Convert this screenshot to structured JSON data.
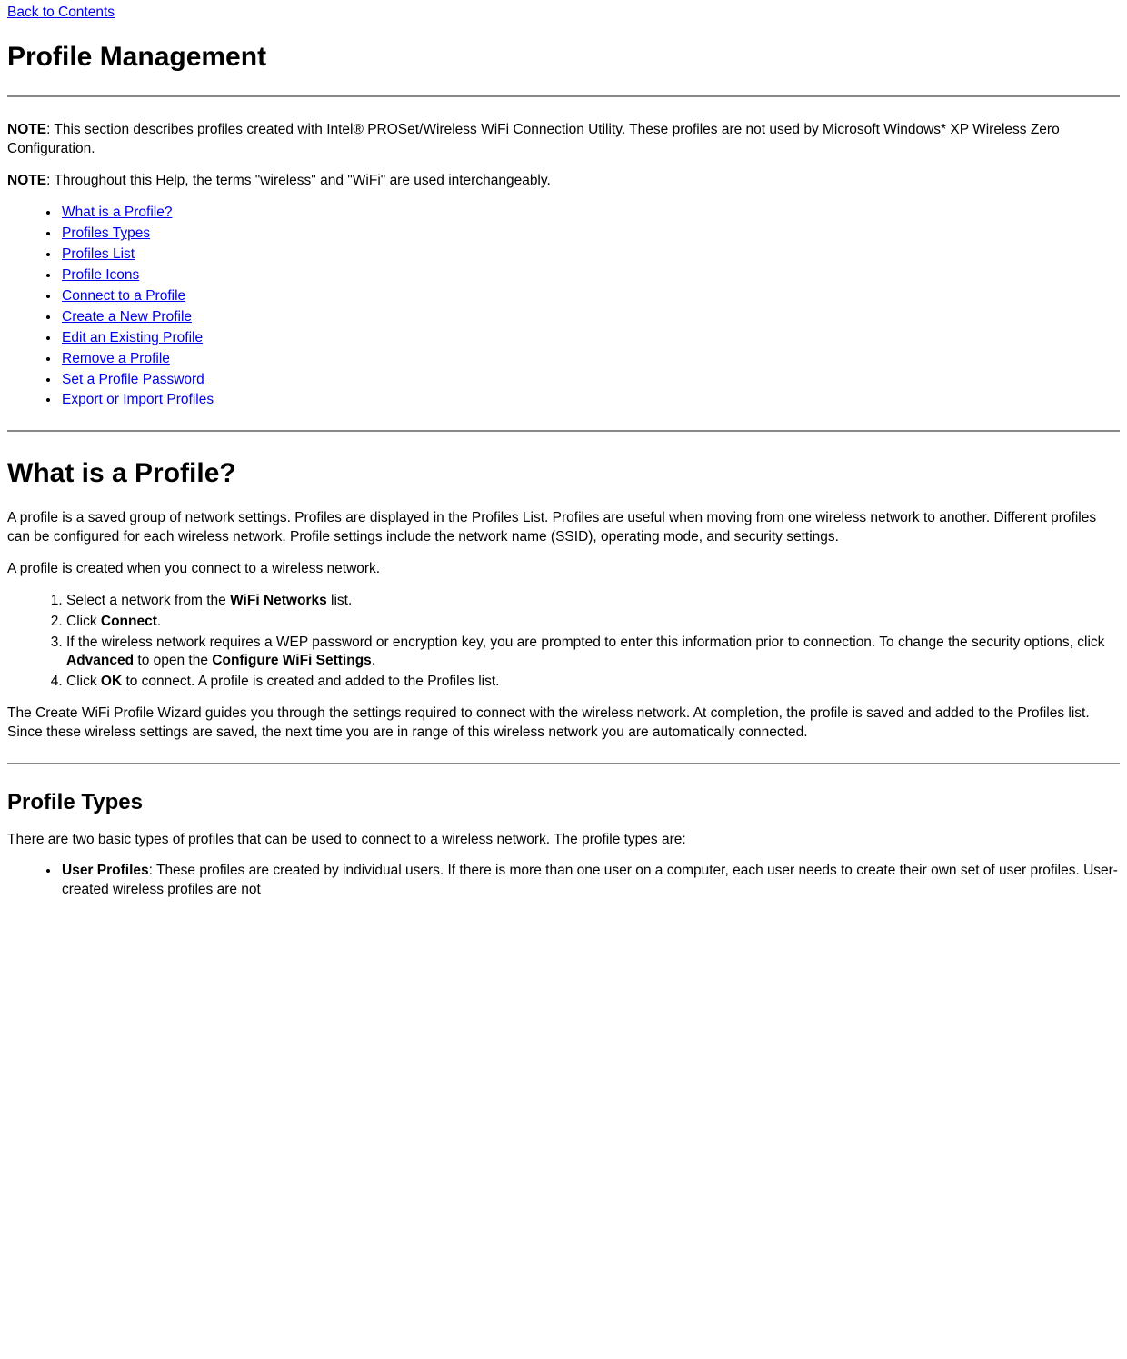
{
  "topLink": "Back to Contents",
  "pageTitle": "Profile Management",
  "note1Label": "NOTE",
  "note1Text": ": This section describes profiles created with Intel® PROSet/Wireless WiFi Connection Utility. These profiles are not used by Microsoft Windows* XP Wireless Zero Configuration.",
  "note2Label": "NOTE",
  "note2Text": ": Throughout this Help, the terms \"wireless\" and \"WiFi\" are used interchangeably.",
  "tocLinks": [
    "What is a Profile?",
    "Profiles Types",
    "Profiles List",
    "Profile Icons",
    "Connect to a Profile",
    "Create a New Profile",
    "Edit an Existing Profile",
    "Remove a Profile",
    "Set a Profile Password",
    "Export or Import Profiles"
  ],
  "section1": {
    "heading": "What is a Profile?",
    "para1": "A profile is a saved group of network settings. Profiles are displayed in the Profiles List. Profiles are useful when moving from one wireless network to another. Different profiles can be configured for each wireless network. Profile settings include the network name (SSID), operating mode, and security settings.",
    "para2": "A profile is created when you connect to a wireless network.",
    "ol": {
      "i1a": "Select a network from the ",
      "i1b": "WiFi Networks",
      "i1c": " list.",
      "i2a": "Click ",
      "i2b": "Connect",
      "i2c": ".",
      "i3a": "If the wireless network requires a WEP password or encryption key, you are prompted to enter this information prior to connection. To change the security options, click ",
      "i3b": "Advanced",
      "i3c": " to open the ",
      "i3d": "Configure WiFi Settings",
      "i3e": ".",
      "i4a": "Click ",
      "i4b": "OK",
      "i4c": " to connect. A profile is created and added to the Profiles list."
    },
    "para3": "The Create WiFi Profile Wizard guides you through the settings required to connect with the wireless network. At completion, the profile is saved and added to the Profiles list. Since these wireless settings are saved, the next time you are in range of this wireless network you are automatically connected."
  },
  "section2": {
    "heading": "Profile Types",
    "para1": "There are two basic types of profiles that can be used to connect to a wireless network. The profile types are:",
    "item1Label": "User Profiles",
    "item1Text": ": These profiles are created by individual users. If there is more than one user on a computer, each user needs to create their own set of user profiles. User-created wireless profiles are not"
  }
}
